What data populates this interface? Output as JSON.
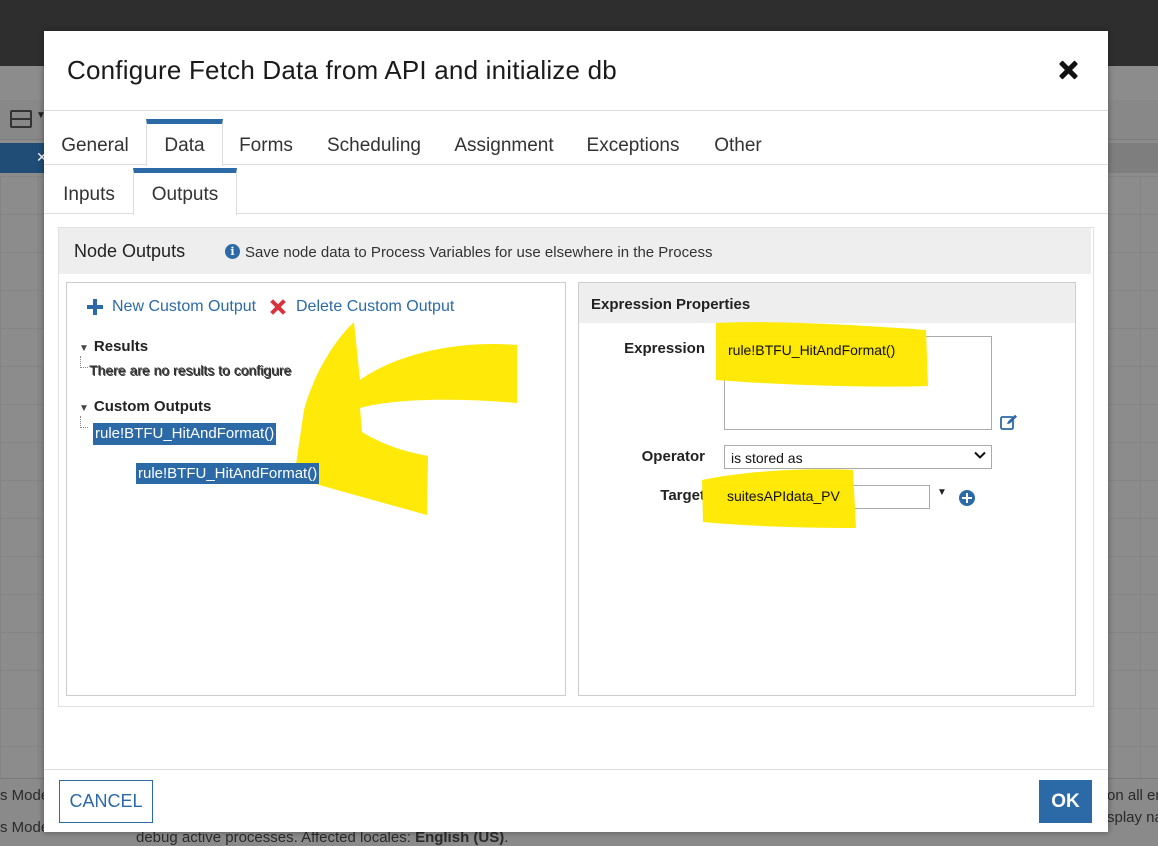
{
  "background": {
    "tab_close": "✕",
    "bottom_left_1": "s Mode",
    "bottom_left_2": "s Mode",
    "bottom_right_1": "on all en",
    "bottom_right_2": "splay na",
    "bottom_sentence_prefix": "debug active processes. Affected locales: ",
    "bottom_sentence_bold": "English (US)",
    "bottom_sentence_suffix": "."
  },
  "dialog": {
    "title": "Configure Fetch Data from API and initialize db",
    "tabs": [
      "General",
      "Data",
      "Forms",
      "Scheduling",
      "Assignment",
      "Exceptions",
      "Other"
    ],
    "active_tab": "Data",
    "subtabs": [
      "Inputs",
      "Outputs"
    ],
    "active_subtab": "Outputs"
  },
  "node_outputs": {
    "title": "Node Outputs",
    "hint": "Save node data to Process Variables for use elsewhere in the Process",
    "new_custom_output": "New Custom Output",
    "delete_custom_output": "Delete Custom Output",
    "results_label": "Results",
    "results_empty": "There are no results to configure",
    "custom_outputs_label": "Custom Outputs",
    "selected_output": "rule!BTFU_HitAndFormat()"
  },
  "expression_properties": {
    "title": "Expression Properties",
    "expression_label": "Expression",
    "expression_value": "rule!BTFU_HitAndFormat()",
    "operator_label": "Operator",
    "operator_value": "is stored as",
    "target_label": "Target",
    "target_value": "suitesAPIdata_PV"
  },
  "footer": {
    "cancel": "CANCEL",
    "ok": "OK"
  },
  "colors": {
    "accent": "#2c6aa7",
    "delete": "#d9323b",
    "annotation": "#ffe800"
  }
}
